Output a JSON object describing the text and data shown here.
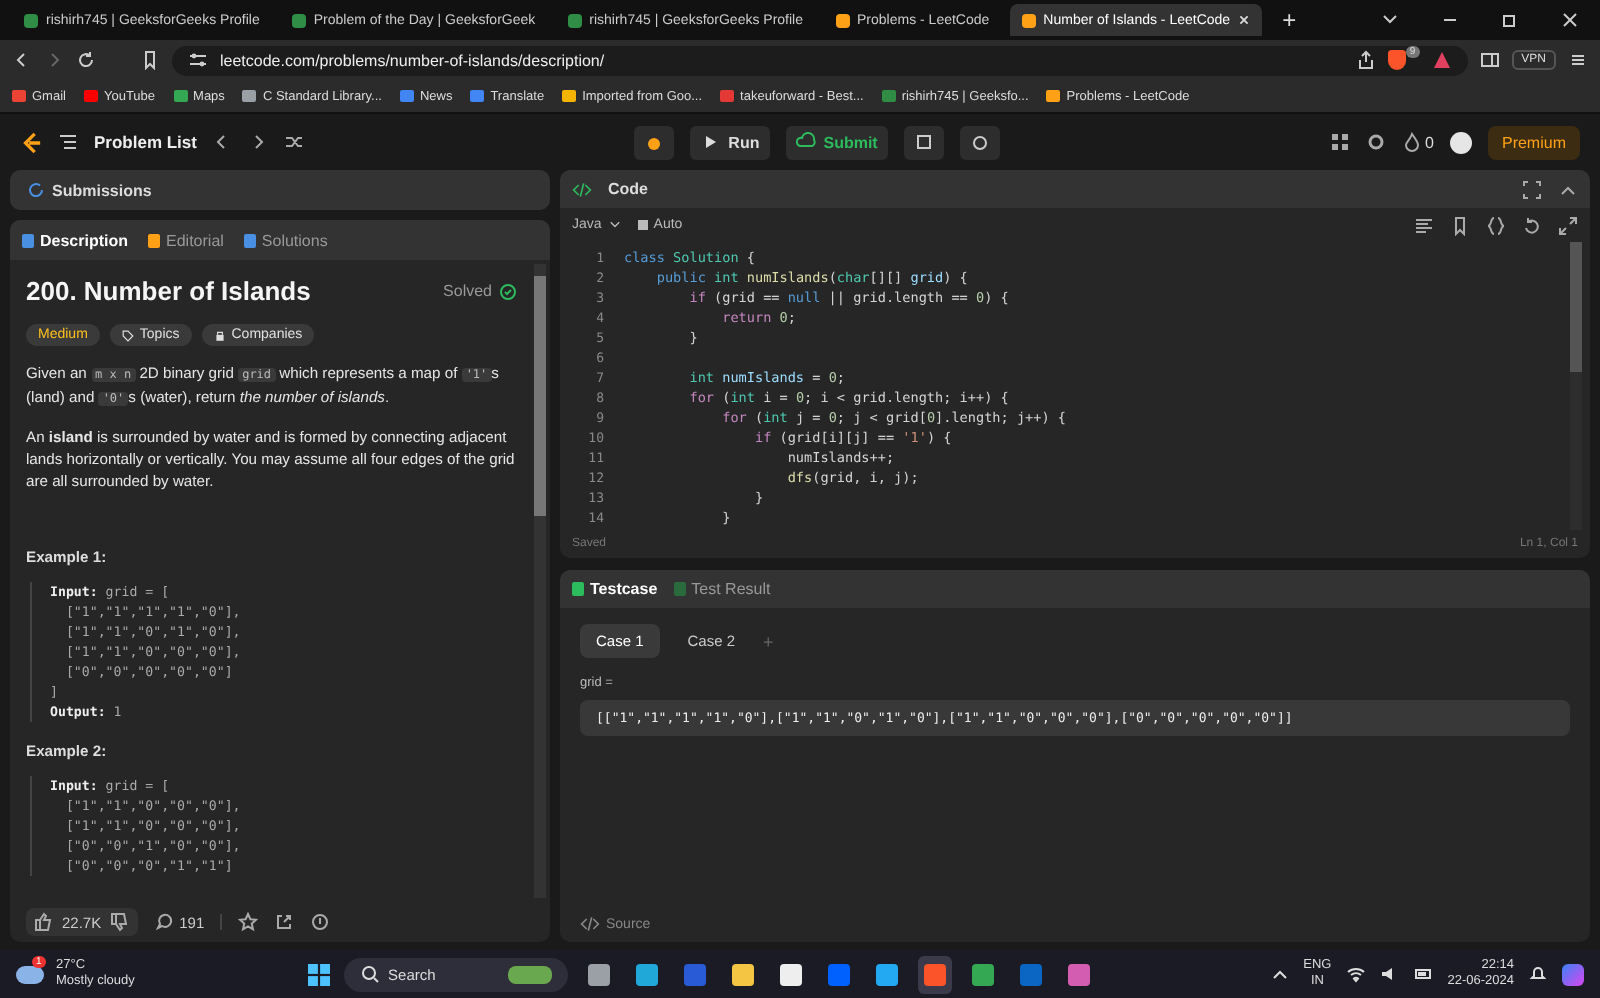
{
  "browser": {
    "tabs": [
      {
        "title": "rishirh745 | GeeksforGeeks Profile",
        "selected": false
      },
      {
        "title": "Problem of the Day | GeeksforGeek",
        "selected": false
      },
      {
        "title": "rishirh745 | GeeksforGeeks Profile",
        "selected": false
      },
      {
        "title": "Problems - LeetCode",
        "selected": false
      },
      {
        "title": "Number of Islands - LeetCode",
        "selected": true
      }
    ],
    "new_tab": "+",
    "url": "leetcode.com/problems/number-of-islands/description/",
    "brave_badge": "9",
    "vpn": "VPN",
    "bookmarks": [
      "Gmail",
      "YouTube",
      "Maps",
      "C Standard Library...",
      "News",
      "Translate",
      "Imported from Goo...",
      "takeuforward - Best...",
      "rishirh745 | Geeksfo...",
      "Problems - LeetCode"
    ]
  },
  "header": {
    "problem_list": "Problem List",
    "run": "Run",
    "submit": "Submit",
    "streak": "0",
    "premium": "Premium"
  },
  "submissions_tab": "Submissions",
  "description": {
    "tabs": [
      {
        "label": "Description",
        "selected": true
      },
      {
        "label": "Editorial",
        "selected": false
      },
      {
        "label": "Solutions",
        "selected": false
      }
    ],
    "title": "200. Number of Islands",
    "solved": "Solved",
    "tags": [
      {
        "label": "Medium",
        "kind": "difficulty"
      },
      {
        "label": "Topics",
        "kind": "topics"
      },
      {
        "label": "Companies",
        "kind": "companies"
      }
    ],
    "paragraphs": [
      [
        {
          "kind": "text",
          "text": "Given an "
        },
        {
          "kind": "code",
          "text": "m x n"
        },
        {
          "kind": "text",
          "text": " 2D binary grid "
        },
        {
          "kind": "code",
          "text": "grid"
        },
        {
          "kind": "text",
          "text": " which represents a map of "
        },
        {
          "kind": "code",
          "text": "'1'"
        },
        {
          "kind": "text",
          "text": "s (land) and "
        },
        {
          "kind": "code",
          "text": "'0'"
        },
        {
          "kind": "text",
          "text": "s (water), return *the number of islands*."
        }
      ],
      [
        {
          "kind": "text",
          "text": "An **island** is surrounded by water and is formed by connecting adjacent lands horizontally or vertically. You may assume all four edges of the grid are all surrounded by water."
        }
      ]
    ],
    "examples": [
      {
        "title": "Example 1:",
        "lines": [
          {
            "label": "Input:",
            "text": " grid = ["
          },
          {
            "text": "  [\"1\",\"1\",\"1\",\"1\",\"0\"],"
          },
          {
            "text": "  [\"1\",\"1\",\"0\",\"1\",\"0\"],"
          },
          {
            "text": "  [\"1\",\"1\",\"0\",\"0\",\"0\"],"
          },
          {
            "text": "  [\"0\",\"0\",\"0\",\"0\",\"0\"]"
          },
          {
            "text": "]"
          },
          {
            "label": "Output:",
            "text": " 1"
          }
        ]
      },
      {
        "title": "Example 2:",
        "lines": [
          {
            "label": "Input:",
            "text": " grid = ["
          },
          {
            "text": "  [\"1\",\"1\",\"0\",\"0\",\"0\"],"
          },
          {
            "text": "  [\"1\",\"1\",\"0\",\"0\",\"0\"],"
          },
          {
            "text": "  [\"0\",\"0\",\"1\",\"0\",\"0\"],"
          },
          {
            "text": "  [\"0\",\"0\",\"0\",\"1\",\"1\"]"
          }
        ]
      }
    ],
    "likes": "22.7K",
    "comments": "191"
  },
  "code": {
    "title": "Code",
    "language": "Java",
    "auto": "Auto",
    "status": "Saved",
    "position": "Ln 1, Col 1",
    "lines": [
      {
        "number": "1",
        "tokens": [
          {
            "kind": "decl",
            "t": "class"
          },
          {
            "kind": "type",
            "t": " Solution"
          },
          {
            "kind": "plain",
            "t": " {"
          }
        ]
      },
      {
        "number": "2",
        "tokens": [
          {
            "kind": "decl",
            "t": "    public"
          },
          {
            "kind": "type",
            "t": " int"
          },
          {
            "kind": "fn",
            "t": " numIslands"
          },
          {
            "kind": "plain",
            "t": "("
          },
          {
            "kind": "type",
            "t": "char"
          },
          {
            "kind": "plain",
            "t": "[][] "
          },
          {
            "kind": "var",
            "t": "grid"
          },
          {
            "kind": "plain",
            "t": ") {"
          }
        ]
      },
      {
        "number": "3",
        "tokens": [
          {
            "kind": "ctrl",
            "t": "        if"
          },
          {
            "kind": "plain",
            "t": " (grid == "
          },
          {
            "kind": "decl",
            "t": "null"
          },
          {
            "kind": "plain",
            "t": " || grid.length == "
          },
          {
            "kind": "num",
            "t": "0"
          },
          {
            "kind": "plain",
            "t": ") {"
          }
        ]
      },
      {
        "number": "4",
        "tokens": [
          {
            "kind": "ctrl",
            "t": "            return"
          },
          {
            "kind": "num",
            "t": " 0"
          },
          {
            "kind": "plain",
            "t": ";"
          }
        ]
      },
      {
        "number": "5",
        "tokens": [
          {
            "kind": "plain",
            "t": "        }"
          }
        ]
      },
      {
        "number": "6"
      },
      {
        "number": "7",
        "tokens": [
          {
            "kind": "type",
            "t": "        int"
          },
          {
            "kind": "var",
            "t": " numIslands"
          },
          {
            "kind": "plain",
            "t": " = "
          },
          {
            "kind": "num",
            "t": "0"
          },
          {
            "kind": "plain",
            "t": ";"
          }
        ]
      },
      {
        "number": "8",
        "tokens": [
          {
            "kind": "ctrl",
            "t": "        for"
          },
          {
            "kind": "plain",
            "t": " ("
          },
          {
            "kind": "type",
            "t": "int"
          },
          {
            "kind": "plain",
            "t": " i = "
          },
          {
            "kind": "num",
            "t": "0"
          },
          {
            "kind": "plain",
            "t": "; i < grid.length; i++) {"
          }
        ]
      },
      {
        "number": "9",
        "tokens": [
          {
            "kind": "ctrl",
            "t": "            for"
          },
          {
            "kind": "plain",
            "t": " ("
          },
          {
            "kind": "type",
            "t": "int"
          },
          {
            "kind": "plain",
            "t": " j = "
          },
          {
            "kind": "num",
            "t": "0"
          },
          {
            "kind": "plain",
            "t": "; j < grid["
          },
          {
            "kind": "num",
            "t": "0"
          },
          {
            "kind": "plain",
            "t": "].length; j++) {"
          }
        ]
      },
      {
        "number": "10",
        "tokens": [
          {
            "kind": "ctrl",
            "t": "                if"
          },
          {
            "kind": "plain",
            "t": " (grid[i][j] == "
          },
          {
            "kind": "str",
            "t": "'1'"
          },
          {
            "kind": "plain",
            "t": ") {"
          }
        ]
      },
      {
        "number": "11",
        "tokens": [
          {
            "kind": "plain",
            "t": "                    numIslands++;"
          }
        ]
      },
      {
        "number": "12",
        "tokens": [
          {
            "kind": "fn",
            "t": "                    dfs"
          },
          {
            "kind": "plain",
            "t": "(grid, i, j);"
          }
        ]
      },
      {
        "number": "13",
        "tokens": [
          {
            "kind": "plain",
            "t": "                }"
          }
        ]
      },
      {
        "number": "14",
        "tokens": [
          {
            "kind": "plain",
            "t": "            }"
          }
        ]
      }
    ]
  },
  "testcase": {
    "tabs": [
      {
        "label": "Testcase",
        "selected": true
      },
      {
        "label": "Test Result",
        "selected": false
      }
    ],
    "cases": [
      {
        "label": "Case 1",
        "selected": true
      },
      {
        "label": "Case 2",
        "selected": false
      }
    ],
    "add": "+",
    "param_label": "grid =",
    "param_value": "[[\"1\",\"1\",\"1\",\"1\",\"0\"],[\"1\",\"1\",\"0\",\"1\",\"0\"],[\"1\",\"1\",\"0\",\"0\",\"0\"],[\"0\",\"0\",\"0\",\"0\",\"0\"]]",
    "source": "Source"
  },
  "taskbar": {
    "weather_badge": "1",
    "temperature": "27°C",
    "weather": "Mostly cloudy",
    "search": "Search",
    "apps": [
      {
        "selected": false
      },
      {
        "selected": false
      },
      {
        "selected": false
      },
      {
        "selected": false
      },
      {
        "selected": false
      },
      {
        "selected": false
      },
      {
        "selected": false
      },
      {
        "selected": true
      },
      {
        "selected": false
      },
      {
        "selected": false
      },
      {
        "selected": false
      }
    ],
    "lang": "ENG",
    "region": "IN",
    "time": "22:14",
    "date": "22-06-2024"
  }
}
